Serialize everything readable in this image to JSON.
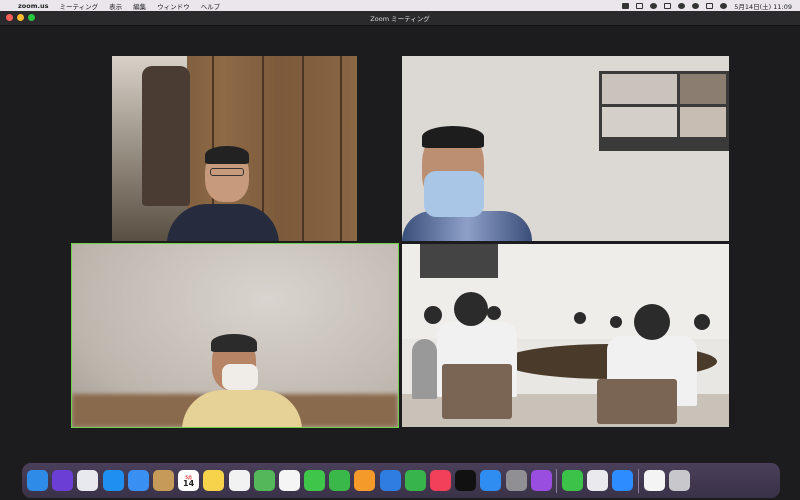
{
  "menubar": {
    "app_name": "zoom.us",
    "menus": [
      "ミーティング",
      "表示",
      "編集",
      "ウィンドウ",
      "ヘルプ"
    ],
    "datetime": "5月14日(土) 11:09"
  },
  "window": {
    "title": "Zoom ミーティング"
  },
  "participants": [
    {
      "tile": 1,
      "active": false
    },
    {
      "tile": 2,
      "active": false
    },
    {
      "tile": 3,
      "active": true
    },
    {
      "tile": 4,
      "active": false
    }
  ],
  "dock": {
    "calendar_month": "5月",
    "calendar_day": "14",
    "apps": [
      {
        "icon": "finder-icon",
        "color": "#2f8be8"
      },
      {
        "icon": "siri-icon",
        "color": "#6b3fd6"
      },
      {
        "icon": "launchpad-icon",
        "color": "#e8e8ef"
      },
      {
        "icon": "safari-icon",
        "color": "#1f8ff0"
      },
      {
        "icon": "mail-icon",
        "color": "#3a8ff3"
      },
      {
        "icon": "contacts-icon",
        "color": "#c69b59"
      },
      {
        "icon": "calendar-icon",
        "color": "#ffffff"
      },
      {
        "icon": "notes-icon",
        "color": "#f6d34a"
      },
      {
        "icon": "reminders-icon",
        "color": "#f2f2f2"
      },
      {
        "icon": "maps-icon",
        "color": "#54b85a"
      },
      {
        "icon": "photos-icon",
        "color": "#f5f5f5"
      },
      {
        "icon": "messages-icon",
        "color": "#3fc54a"
      },
      {
        "icon": "facetime-icon",
        "color": "#3ab84a"
      },
      {
        "icon": "pages-icon",
        "color": "#f49a2a"
      },
      {
        "icon": "keynote-icon",
        "color": "#2f7de0"
      },
      {
        "icon": "numbers-icon",
        "color": "#38b54a"
      },
      {
        "icon": "music-icon",
        "color": "#f3405a"
      },
      {
        "icon": "appletv-icon",
        "color": "#111111"
      },
      {
        "icon": "appstore-icon",
        "color": "#2f8cf0"
      },
      {
        "icon": "settings-icon",
        "color": "#8f8f94"
      },
      {
        "icon": "podcasts-icon",
        "color": "#9a4ee0"
      },
      {
        "icon": "line-icon",
        "color": "#3cc248"
      },
      {
        "icon": "preview-icon",
        "color": "#e9e9ee"
      },
      {
        "icon": "zoom-icon",
        "color": "#2d8cff"
      },
      {
        "icon": "document-icon",
        "color": "#f4f4f4"
      },
      {
        "icon": "trash-icon",
        "color": "#c8c8cc"
      }
    ]
  }
}
